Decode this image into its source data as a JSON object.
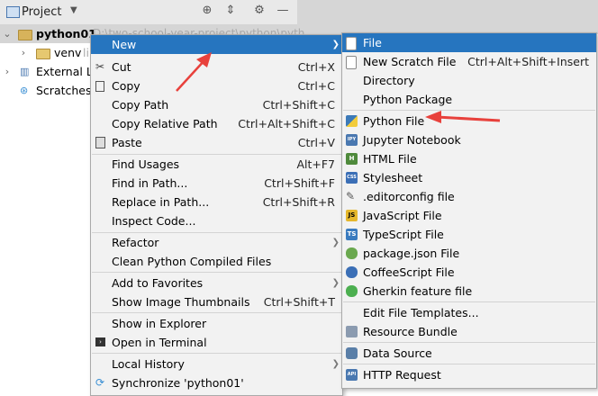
{
  "project_header": {
    "title": "Project"
  },
  "tree": {
    "root_label": "python01",
    "root_path": "D:\\two-school-year-project\\python\\pyth",
    "venv_label": "venv",
    "venv_suffix": "li",
    "external_label": "External Li",
    "scratches_label": "Scratches"
  },
  "context_menu": {
    "new": "New",
    "cut": "Cut",
    "cut_sc": "Ctrl+X",
    "copy": "Copy",
    "copy_sc": "Ctrl+C",
    "copy_path": "Copy Path",
    "copy_path_sc": "Ctrl+Shift+C",
    "copy_relative": "Copy Relative Path",
    "copy_relative_sc": "Ctrl+Alt+Shift+C",
    "paste": "Paste",
    "paste_sc": "Ctrl+V",
    "find_usages": "Find Usages",
    "find_usages_sc": "Alt+F7",
    "find_in_path": "Find in Path...",
    "find_in_path_sc": "Ctrl+Shift+F",
    "replace_in_path": "Replace in Path...",
    "replace_in_path_sc": "Ctrl+Shift+R",
    "inspect_code": "Inspect Code...",
    "refactor": "Refactor",
    "clean_compiled": "Clean Python Compiled Files",
    "add_favorites": "Add to Favorites",
    "show_thumbnails": "Show Image Thumbnails",
    "show_thumbnails_sc": "Ctrl+Shift+T",
    "show_explorer": "Show in Explorer",
    "open_terminal": "Open in Terminal",
    "local_history": "Local History",
    "synchronize": "Synchronize 'python01'"
  },
  "new_submenu": {
    "file": "File",
    "scratch": "New Scratch File",
    "scratch_sc": "Ctrl+Alt+Shift+Insert",
    "directory": "Directory",
    "python_package": "Python Package",
    "python_file": "Python File",
    "jupyter": "Jupyter Notebook",
    "html": "HTML File",
    "stylesheet": "Stylesheet",
    "editorconfig": ".editorconfig file",
    "javascript": "JavaScript File",
    "typescript": "TypeScript File",
    "package_json": "package.json File",
    "coffeescript": "CoffeeScript File",
    "gherkin": "Gherkin feature file",
    "edit_templates": "Edit File Templates...",
    "resource_bundle": "Resource Bundle",
    "data_source": "Data Source",
    "http_request": "HTTP Request"
  },
  "icon_labels": {
    "jupyter": "IPY",
    "html": "H",
    "css": "CSS",
    "js": "JS",
    "ts": "TS",
    "api": "API"
  },
  "colors": {
    "selection": "#2675bf",
    "menu_bg": "#f2f2f2",
    "annotation_arrow": "#e8413c"
  }
}
